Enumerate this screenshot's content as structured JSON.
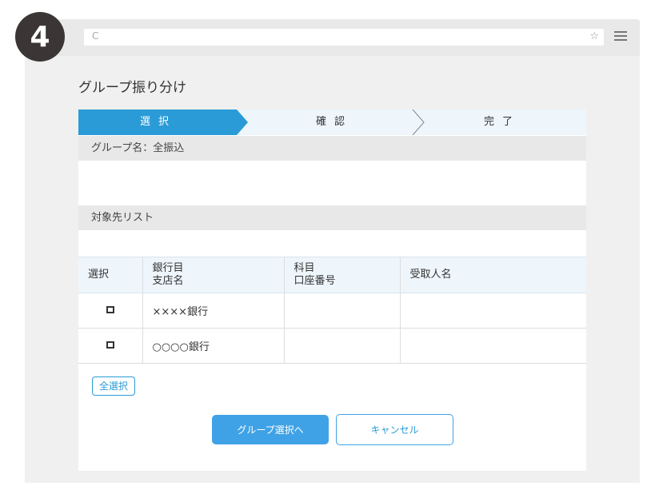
{
  "step_badge": "4",
  "page": {
    "title": "グループ振り分け"
  },
  "steps": [
    {
      "label": "選択",
      "state": "active"
    },
    {
      "label": "確認",
      "state": "inactive"
    },
    {
      "label": "完了",
      "state": "inactive"
    }
  ],
  "group": {
    "heading": "グループ名：全振込"
  },
  "recipients": {
    "heading": "対象先リスト",
    "columns": {
      "select": "選択",
      "bank_line1": "銀行目",
      "bank_line2": "支店名",
      "account_line1": "科目",
      "account_line2": "口座番号",
      "payee": "受取人名"
    },
    "rows": [
      {
        "bank": "××××銀行",
        "account": "",
        "payee": "",
        "checked": false
      },
      {
        "bank": "○○○○銀行",
        "account": "",
        "payee": "",
        "checked": false
      }
    ]
  },
  "buttons": {
    "select_all": "全選択",
    "to_group_select": "グループ選択へ",
    "cancel": "キャンセル"
  },
  "colors": {
    "active_step": "#2a9bd6",
    "step_bg": "#eef6fc",
    "primary_button": "#3fa2e6",
    "badge": "#3b3635"
  },
  "icons": {
    "reload": "reload-icon",
    "bookmark": "star-icon",
    "menu": "hamburger-menu-icon"
  }
}
